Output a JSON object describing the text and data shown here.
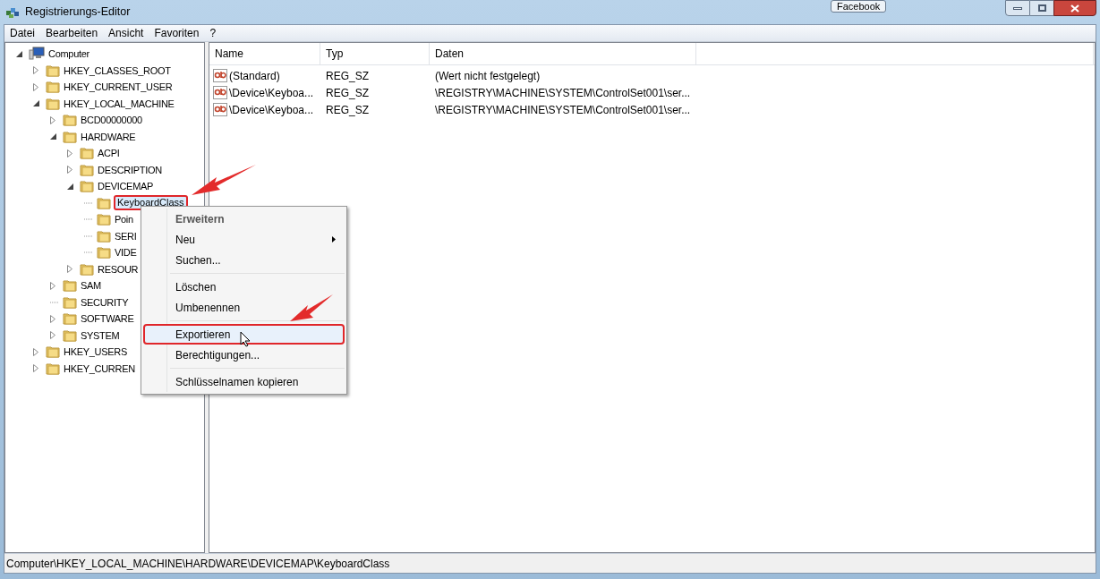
{
  "window": {
    "title": "Registrierungs-Editor",
    "background_tab": "Facebook"
  },
  "menu_bar": [
    "Datei",
    "Bearbeiten",
    "Ansicht",
    "Favoriten",
    "?"
  ],
  "tree": [
    {
      "label": "Computer",
      "kind": "expanded",
      "selected": false,
      "children": [
        {
          "label": "HKEY_CLASSES_ROOT",
          "kind": "collapsed",
          "selected": false
        },
        {
          "label": "HKEY_CURRENT_USER",
          "kind": "collapsed",
          "selected": false
        },
        {
          "label": "HKEY_LOCAL_MACHINE",
          "kind": "expanded",
          "selected": false,
          "children": [
            {
              "label": "BCD00000000",
              "kind": "collapsed",
              "selected": false
            },
            {
              "label": "HARDWARE",
              "kind": "expanded",
              "selected": false,
              "children": [
                {
                  "label": "ACPI",
                  "kind": "collapsed",
                  "selected": false
                },
                {
                  "label": "DESCRIPTION",
                  "kind": "collapsed",
                  "selected": false
                },
                {
                  "label": "DEVICEMAP",
                  "kind": "expanded",
                  "selected": false,
                  "children": [
                    {
                      "label": "KeyboardClass",
                      "kind": "leaf",
                      "selected": true
                    },
                    {
                      "label": "Poin",
                      "kind": "leaf",
                      "selected": false
                    },
                    {
                      "label": "SERI",
                      "kind": "leaf",
                      "selected": false
                    },
                    {
                      "label": "VIDE",
                      "kind": "leaf",
                      "selected": false
                    }
                  ]
                },
                {
                  "label": "RESOUR",
                  "kind": "collapsed",
                  "selected": false
                }
              ]
            },
            {
              "label": "SAM",
              "kind": "collapsed",
              "selected": false
            },
            {
              "label": "SECURITY",
              "kind": "leaf",
              "selected": false
            },
            {
              "label": "SOFTWARE",
              "kind": "collapsed",
              "selected": false
            },
            {
              "label": "SYSTEM",
              "kind": "collapsed",
              "selected": false
            }
          ]
        },
        {
          "label": "HKEY_USERS",
          "kind": "collapsed",
          "selected": false
        },
        {
          "label": "HKEY_CURREN",
          "kind": "collapsed",
          "selected": false
        }
      ]
    }
  ],
  "table": {
    "columns": [
      "Name",
      "Typ",
      "Daten"
    ],
    "rows": [
      [
        "(Standard)",
        "REG_SZ",
        "(Wert nicht festgelegt)"
      ],
      [
        "\\Device\\Keyboa...",
        "REG_SZ",
        "\\REGISTRY\\MACHINE\\SYSTEM\\ControlSet001\\ser..."
      ],
      [
        "\\Device\\Keyboa...",
        "REG_SZ",
        "\\REGISTRY\\MACHINE\\SYSTEM\\ControlSet001\\ser..."
      ]
    ]
  },
  "context_menu": [
    {
      "kind": "header",
      "label": "Erweitern",
      "selected": false
    },
    {
      "kind": "submenu",
      "label": "Neu",
      "selected": false
    },
    {
      "kind": "item",
      "label": "Suchen...",
      "selected": false
    },
    {
      "kind": "separator"
    },
    {
      "kind": "item",
      "label": "Löschen",
      "selected": false
    },
    {
      "kind": "item",
      "label": "Umbenennen",
      "selected": false
    },
    {
      "kind": "separator"
    },
    {
      "kind": "item",
      "label": "Exportieren",
      "selected": true
    },
    {
      "kind": "item",
      "label": "Berechtigungen...",
      "selected": false
    },
    {
      "kind": "separator"
    },
    {
      "kind": "item",
      "label": "Schlüsselnamen kopieren",
      "selected": false
    }
  ],
  "status_bar": "Computer\\HKEY_LOCAL_MACHINE\\HARDWARE\\DEVICEMAP\\KeyboardClass"
}
